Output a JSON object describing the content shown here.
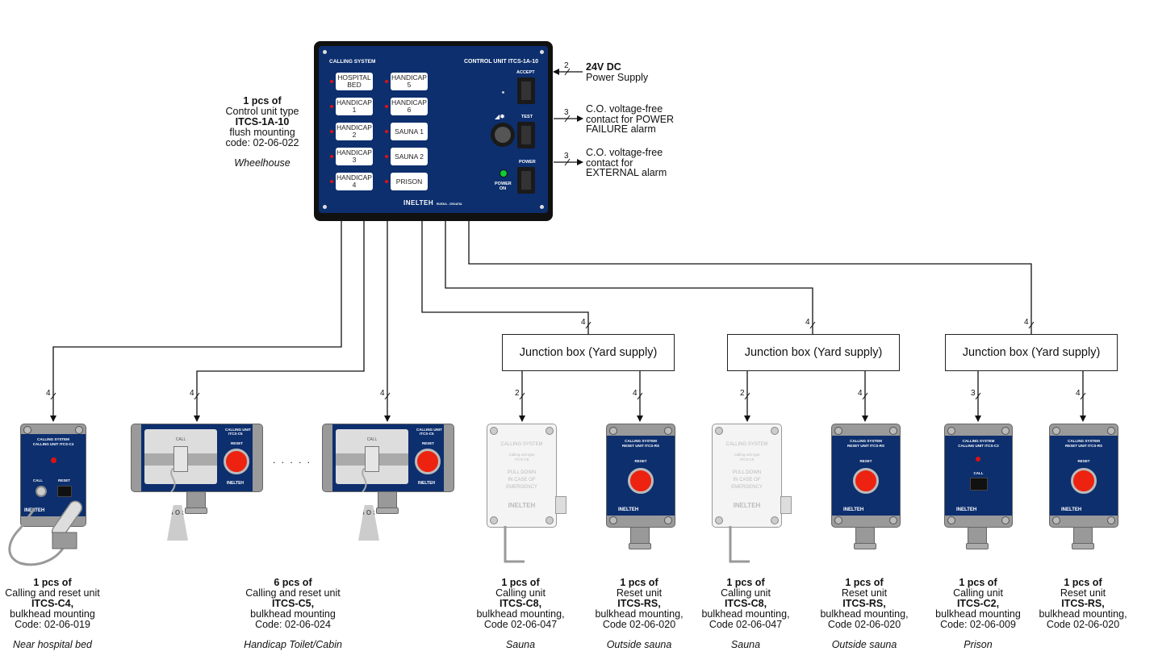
{
  "control_unit": {
    "panel_title_left": "CALLING SYSTEM",
    "panel_title_right": "CONTROL UNIT  ITCS-1A-10",
    "zones_left": [
      "HOSPITAL BED",
      "HANDICAP 1",
      "HANDICAP 2",
      "HANDICAP 3",
      "HANDICAP 4"
    ],
    "zones_right": [
      "HANDICAP 5",
      "HANDICAP 6",
      "SAUNA 1",
      "SAUNA 2",
      "PRISON"
    ],
    "buttons": {
      "accept": "ACCEPT",
      "test": "TEST",
      "power": "POWER"
    },
    "power_on_label": "POWER ON",
    "logo": "INELTEH",
    "logo_sub": "RIJEKA - CROATIA",
    "note": {
      "qty": "1 pcs of",
      "line1": "Control unit type",
      "model": "ITCS-1A-10",
      "line2": "flush mounting",
      "code": "code: 02-06-022",
      "location": "Wheelhouse"
    }
  },
  "right_connections": [
    {
      "wires": "2",
      "title": "24V DC",
      "text": "Power Supply"
    },
    {
      "wires": "3",
      "text": "C.O. voltage-free contact for POWER FAILURE alarm"
    },
    {
      "wires": "3",
      "text": "C.O. voltage-free contact for EXTERNAL alarm"
    }
  ],
  "junction_boxes": [
    {
      "label": "Junction box (Yard supply)",
      "in_wires": "4"
    },
    {
      "label": "Junction box (Yard supply)",
      "in_wires": "4"
    },
    {
      "label": "Junction box (Yard supply)",
      "in_wires": "4"
    }
  ],
  "ellipsis": ". . . . .",
  "device_labels": {
    "c4_header": "CALLING SYSTEM",
    "c4_sub": "CALLING UNIT  ITCS-C4",
    "call": "CALL",
    "reset": "RESET",
    "c5_header": "CALLING UNIT",
    "c5_sub": "ITCS-C5",
    "sos": "S O S",
    "c8_title": "CALLING SYSTEM",
    "c8_sub1": "Calling unit type",
    "c8_sub2": "ITCS-C8",
    "c8_pull": "PULL DOWN",
    "c8_case": "IN CASE OF",
    "c8_emerg": "EMERGENCY",
    "rs_header": "CALLING SYSTEM",
    "rs_sub": "RESET UNIT  ITCS-RS",
    "c2_header": "CALLING SYSTEM",
    "c2_sub": "CALLING UNIT  ITCS-C2",
    "logo": "INELTEH"
  },
  "devices": [
    {
      "wires": "4",
      "qty": "1 pcs of",
      "type": "Calling and reset unit",
      "model": "ITCS-C4,",
      "mount": "bulkhead mounting",
      "code": "Code: 02-06-019",
      "location": "Near hospital bed"
    },
    {
      "wires": "4",
      "qty": "6 pcs of",
      "type": "Calling and reset unit",
      "model": "ITCS-C5,",
      "mount": "bulkhead mounting",
      "code": "Code: 02-06-024",
      "location": "Handicap Toilet/Cabin"
    },
    {
      "wires": "4"
    },
    {
      "wires": "2",
      "qty": "1 pcs of",
      "type": "Calling unit",
      "model": "ITCS-C8,",
      "mount": "bulkhead mounting,",
      "code": "Code 02-06-047",
      "location": "Sauna"
    },
    {
      "wires": "4",
      "qty": "1 pcs of",
      "type": "Reset unit",
      "model": "ITCS-RS,",
      "mount": "bulkhead mounting,",
      "code": "Code 02-06-020",
      "location": "Outside sauna"
    },
    {
      "wires": "2",
      "qty": "1 pcs of",
      "type": "Calling unit",
      "model": "ITCS-C8,",
      "mount": "bulkhead mounting,",
      "code": "Code 02-06-047",
      "location": "Sauna"
    },
    {
      "wires": "4",
      "qty": "1 pcs of",
      "type": "Reset unit",
      "model": "ITCS-RS,",
      "mount": "bulkhead mounting,",
      "code": "Code 02-06-020",
      "location": "Outside sauna"
    },
    {
      "wires": "3",
      "qty": "1 pcs of",
      "type": "Calling unit",
      "model": "ITCS-C2,",
      "mount": "bulkhead mounting",
      "code": "Code: 02-06-009",
      "location": "Prison"
    },
    {
      "wires": "4",
      "qty": "1 pcs of",
      "type": "Reset unit",
      "model": "ITCS-RS,",
      "mount": "bulkhead mounting,",
      "code": "Code 02-06-020",
      "location": ""
    }
  ]
}
